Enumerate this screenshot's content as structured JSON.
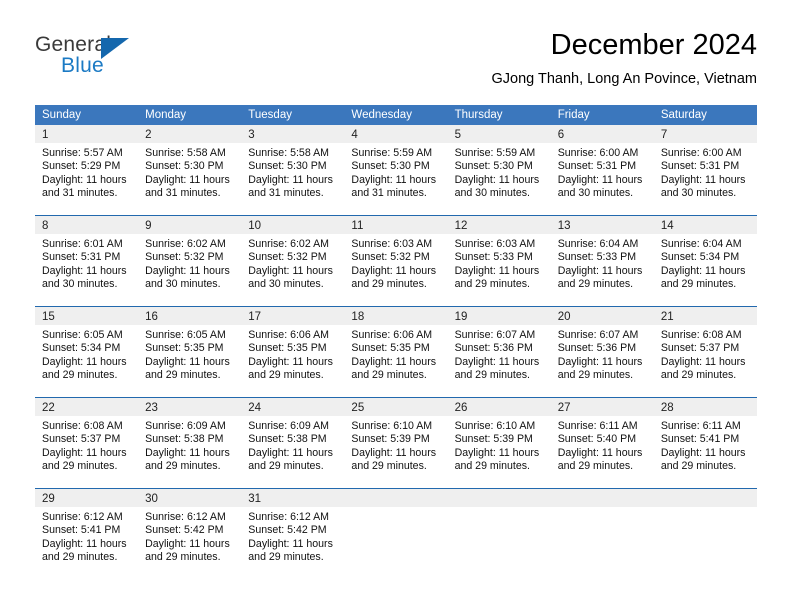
{
  "logo": {
    "word_top": "General",
    "word_bottom": "Blue",
    "triangle_color": "#1467ad",
    "blue_color": "#1b7ac4"
  },
  "header": {
    "title": "December 2024",
    "subtitle": "GJong Thanh, Long An Povince, Vietnam"
  },
  "theme": {
    "header_bg": "#3b77bd",
    "row_divider": "#2269ae",
    "day_band_bg": "#efefef"
  },
  "weekdays": [
    "Sunday",
    "Monday",
    "Tuesday",
    "Wednesday",
    "Thursday",
    "Friday",
    "Saturday"
  ],
  "weeks": [
    [
      {
        "day": "1",
        "sunrise": "Sunrise: 5:57 AM",
        "sunset": "Sunset: 5:29 PM",
        "daylight1": "Daylight: 11 hours",
        "daylight2": "and 31 minutes."
      },
      {
        "day": "2",
        "sunrise": "Sunrise: 5:58 AM",
        "sunset": "Sunset: 5:30 PM",
        "daylight1": "Daylight: 11 hours",
        "daylight2": "and 31 minutes."
      },
      {
        "day": "3",
        "sunrise": "Sunrise: 5:58 AM",
        "sunset": "Sunset: 5:30 PM",
        "daylight1": "Daylight: 11 hours",
        "daylight2": "and 31 minutes."
      },
      {
        "day": "4",
        "sunrise": "Sunrise: 5:59 AM",
        "sunset": "Sunset: 5:30 PM",
        "daylight1": "Daylight: 11 hours",
        "daylight2": "and 31 minutes."
      },
      {
        "day": "5",
        "sunrise": "Sunrise: 5:59 AM",
        "sunset": "Sunset: 5:30 PM",
        "daylight1": "Daylight: 11 hours",
        "daylight2": "and 30 minutes."
      },
      {
        "day": "6",
        "sunrise": "Sunrise: 6:00 AM",
        "sunset": "Sunset: 5:31 PM",
        "daylight1": "Daylight: 11 hours",
        "daylight2": "and 30 minutes."
      },
      {
        "day": "7",
        "sunrise": "Sunrise: 6:00 AM",
        "sunset": "Sunset: 5:31 PM",
        "daylight1": "Daylight: 11 hours",
        "daylight2": "and 30 minutes."
      }
    ],
    [
      {
        "day": "8",
        "sunrise": "Sunrise: 6:01 AM",
        "sunset": "Sunset: 5:31 PM",
        "daylight1": "Daylight: 11 hours",
        "daylight2": "and 30 minutes."
      },
      {
        "day": "9",
        "sunrise": "Sunrise: 6:02 AM",
        "sunset": "Sunset: 5:32 PM",
        "daylight1": "Daylight: 11 hours",
        "daylight2": "and 30 minutes."
      },
      {
        "day": "10",
        "sunrise": "Sunrise: 6:02 AM",
        "sunset": "Sunset: 5:32 PM",
        "daylight1": "Daylight: 11 hours",
        "daylight2": "and 30 minutes."
      },
      {
        "day": "11",
        "sunrise": "Sunrise: 6:03 AM",
        "sunset": "Sunset: 5:32 PM",
        "daylight1": "Daylight: 11 hours",
        "daylight2": "and 29 minutes."
      },
      {
        "day": "12",
        "sunrise": "Sunrise: 6:03 AM",
        "sunset": "Sunset: 5:33 PM",
        "daylight1": "Daylight: 11 hours",
        "daylight2": "and 29 minutes."
      },
      {
        "day": "13",
        "sunrise": "Sunrise: 6:04 AM",
        "sunset": "Sunset: 5:33 PM",
        "daylight1": "Daylight: 11 hours",
        "daylight2": "and 29 minutes."
      },
      {
        "day": "14",
        "sunrise": "Sunrise: 6:04 AM",
        "sunset": "Sunset: 5:34 PM",
        "daylight1": "Daylight: 11 hours",
        "daylight2": "and 29 minutes."
      }
    ],
    [
      {
        "day": "15",
        "sunrise": "Sunrise: 6:05 AM",
        "sunset": "Sunset: 5:34 PM",
        "daylight1": "Daylight: 11 hours",
        "daylight2": "and 29 minutes."
      },
      {
        "day": "16",
        "sunrise": "Sunrise: 6:05 AM",
        "sunset": "Sunset: 5:35 PM",
        "daylight1": "Daylight: 11 hours",
        "daylight2": "and 29 minutes."
      },
      {
        "day": "17",
        "sunrise": "Sunrise: 6:06 AM",
        "sunset": "Sunset: 5:35 PM",
        "daylight1": "Daylight: 11 hours",
        "daylight2": "and 29 minutes."
      },
      {
        "day": "18",
        "sunrise": "Sunrise: 6:06 AM",
        "sunset": "Sunset: 5:35 PM",
        "daylight1": "Daylight: 11 hours",
        "daylight2": "and 29 minutes."
      },
      {
        "day": "19",
        "sunrise": "Sunrise: 6:07 AM",
        "sunset": "Sunset: 5:36 PM",
        "daylight1": "Daylight: 11 hours",
        "daylight2": "and 29 minutes."
      },
      {
        "day": "20",
        "sunrise": "Sunrise: 6:07 AM",
        "sunset": "Sunset: 5:36 PM",
        "daylight1": "Daylight: 11 hours",
        "daylight2": "and 29 minutes."
      },
      {
        "day": "21",
        "sunrise": "Sunrise: 6:08 AM",
        "sunset": "Sunset: 5:37 PM",
        "daylight1": "Daylight: 11 hours",
        "daylight2": "and 29 minutes."
      }
    ],
    [
      {
        "day": "22",
        "sunrise": "Sunrise: 6:08 AM",
        "sunset": "Sunset: 5:37 PM",
        "daylight1": "Daylight: 11 hours",
        "daylight2": "and 29 minutes."
      },
      {
        "day": "23",
        "sunrise": "Sunrise: 6:09 AM",
        "sunset": "Sunset: 5:38 PM",
        "daylight1": "Daylight: 11 hours",
        "daylight2": "and 29 minutes."
      },
      {
        "day": "24",
        "sunrise": "Sunrise: 6:09 AM",
        "sunset": "Sunset: 5:38 PM",
        "daylight1": "Daylight: 11 hours",
        "daylight2": "and 29 minutes."
      },
      {
        "day": "25",
        "sunrise": "Sunrise: 6:10 AM",
        "sunset": "Sunset: 5:39 PM",
        "daylight1": "Daylight: 11 hours",
        "daylight2": "and 29 minutes."
      },
      {
        "day": "26",
        "sunrise": "Sunrise: 6:10 AM",
        "sunset": "Sunset: 5:39 PM",
        "daylight1": "Daylight: 11 hours",
        "daylight2": "and 29 minutes."
      },
      {
        "day": "27",
        "sunrise": "Sunrise: 6:11 AM",
        "sunset": "Sunset: 5:40 PM",
        "daylight1": "Daylight: 11 hours",
        "daylight2": "and 29 minutes."
      },
      {
        "day": "28",
        "sunrise": "Sunrise: 6:11 AM",
        "sunset": "Sunset: 5:41 PM",
        "daylight1": "Daylight: 11 hours",
        "daylight2": "and 29 minutes."
      }
    ],
    [
      {
        "day": "29",
        "sunrise": "Sunrise: 6:12 AM",
        "sunset": "Sunset: 5:41 PM",
        "daylight1": "Daylight: 11 hours",
        "daylight2": "and 29 minutes."
      },
      {
        "day": "30",
        "sunrise": "Sunrise: 6:12 AM",
        "sunset": "Sunset: 5:42 PM",
        "daylight1": "Daylight: 11 hours",
        "daylight2": "and 29 minutes."
      },
      {
        "day": "31",
        "sunrise": "Sunrise: 6:12 AM",
        "sunset": "Sunset: 5:42 PM",
        "daylight1": "Daylight: 11 hours",
        "daylight2": "and 29 minutes."
      },
      {
        "day": "",
        "sunrise": "",
        "sunset": "",
        "daylight1": "",
        "daylight2": ""
      },
      {
        "day": "",
        "sunrise": "",
        "sunset": "",
        "daylight1": "",
        "daylight2": ""
      },
      {
        "day": "",
        "sunrise": "",
        "sunset": "",
        "daylight1": "",
        "daylight2": ""
      },
      {
        "day": "",
        "sunrise": "",
        "sunset": "",
        "daylight1": "",
        "daylight2": ""
      }
    ]
  ]
}
